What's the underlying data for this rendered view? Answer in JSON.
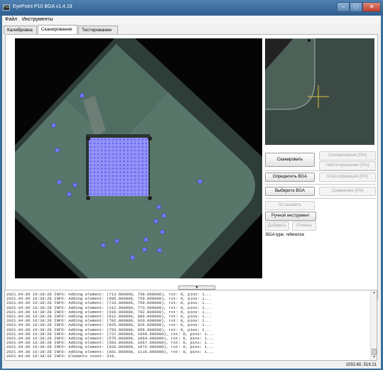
{
  "window": {
    "title": "EyePoint P10 BGA v1.4.19"
  },
  "menu": {
    "items": [
      "Файл",
      "Инструменты"
    ]
  },
  "tabs": [
    "Калибровка",
    "Сканирование",
    "Тестирование"
  ],
  "buttons": {
    "scan": "Сканировать",
    "scan_progress": "Сканирование [0%]",
    "find_rotation": "Найти вращение [0%]",
    "define_bga": "Определить BGA",
    "classify": "Классификация [0%]",
    "choose_bga": "Выберите BGA",
    "compare": "Сравнение [0%]",
    "stop": "Остановить",
    "manual_tool": "Ручной инструмент",
    "add": "Добавить",
    "cancel": "Отмена"
  },
  "bga_type_text": "BGA type: reference",
  "log": [
    "2021.04.06 16:38:28 INFO: Adding element: (713.000000, 758.000000), rot: 0, pins: 1...",
    "2021.04.06 16:38:28 INFO: Adding element: (695.000000, 759.000000), rot: 0, pins: 1...",
    "2021.04.06 16:38:28 INFO: Adding element: (733.000000, 759.000000), rot: 0, pins: 1...",
    "2021.04.06 16:38:28 INFO: Adding element: (212.000000, 773.000000), rot: 0, pins: 1...",
    "2021.04.06 16:38:28 INFO: Adding element: (916.000000, 792.000000), rot: 0, pins: 1...",
    "2021.04.06 16:38:28 INFO: Adding element: (812.000000, 889.000000), rot: 0, pins: 1...",
    "2021.04.06 16:38:28 INFO: Adding element: (782.000000, 920.000000), rot: 0, pins: 1...",
    "2021.04.06 16:38:28 INFO: Adding element: (825.000000, 926.000000), rot: 0, pins: 1...",
    "2021.04.06 16:38:28 INFO: Adding element: (793.000000, 958.000000), rot: 0, pins: 1...",
    "2021.04.06 16:38:28 INFO: Adding element: (737.000000, 1040.000000), rot: 0, pins: 1...",
    "2021.04.06 16:38:28 INFO: Adding element: (575.000000, 1064.000000), rot: 0, pins: 1...",
    "2021.04.06 16:38:28 INFO: Adding element: (503.000000, 1067.000000), rot: 0, pins: 1...",
    "2021.04.06 16:38:28 INFO: Adding element: (633.000000, 1072.000000), rot: 0, pins: 1...",
    "2021.04.06 16:38:28 INFO: Adding element: (661.000000, 1116.000000), rot: 0, pins: 1...",
    "2021.04.06 16:38:28 INFO: Elements count: 319."
  ],
  "status": {
    "coords": "1032.60, 519.21"
  }
}
